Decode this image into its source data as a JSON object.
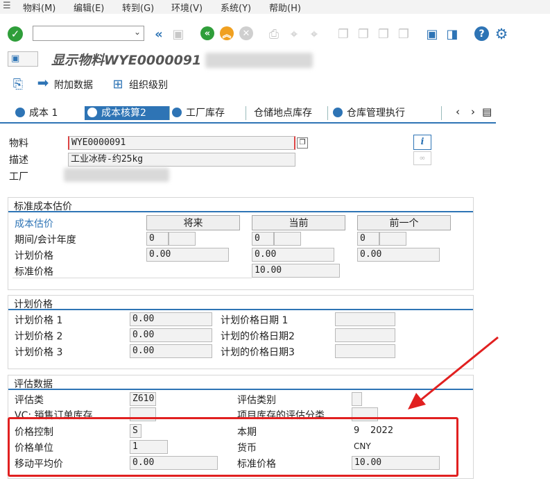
{
  "menu": [
    "物料(M)",
    "编辑(E)",
    "转到(G)",
    "环境(V)",
    "系统(Y)",
    "帮助(H)"
  ],
  "title": "显示物料WYE0000091",
  "toolbar2": {
    "additional_data": "附加数据",
    "org_levels": "组织级别"
  },
  "tabs": [
    "成本 1",
    "成本核算2",
    "工厂库存",
    "仓储地点库存",
    "仓库管理执行"
  ],
  "header": {
    "material_label": "物料",
    "material_value": "WYE0000091",
    "desc_label": "描述",
    "desc_value": "工业冰砖-约25kg",
    "plant_label": "工厂"
  },
  "std_cost": {
    "title": "标准成本估价",
    "cost_est_label": "成本估价",
    "cols": [
      "将来",
      "当前",
      "前一个"
    ],
    "period_label": "期间/会计年度",
    "period_values": [
      "0",
      "0",
      "0"
    ],
    "planned_label": "计划价格",
    "planned_values": [
      "0.00",
      "0.00",
      "0.00"
    ],
    "std_price_label": "标准价格",
    "std_price_value": "10.00"
  },
  "planned_prices": {
    "title": "计划价格",
    "p1_label": "计划价格 1",
    "p1_value": "0.00",
    "p2_label": "计划价格 2",
    "p2_value": "0.00",
    "p3_label": "计划价格 3",
    "p3_value": "0.00",
    "d1_label": "计划价格日期 1",
    "d2_label": "计划的价格日期2",
    "d3_label": "计划的价格日期3"
  },
  "valuation": {
    "title": "评估数据",
    "val_class_label": "评估类",
    "val_class_value": "Z610",
    "vc_label": "VC: 销售订单库存",
    "val_cat_label": "评估类别",
    "proj_label": "项目库存的评估分类",
    "price_ctrl_label": "价格控制",
    "price_ctrl_value": "S",
    "price_unit_label": "价格单位",
    "price_unit_value": "1",
    "mov_avg_label": "移动平均价",
    "mov_avg_value": "0.00",
    "period_label": "本期",
    "period_value": "9",
    "year_value": "2022",
    "currency_label": "货币",
    "currency_value": "CNY",
    "std_price_label": "标准价格",
    "std_price_value": "10.00"
  },
  "accent": "#2e74b5",
  "highlight": "#e12020"
}
